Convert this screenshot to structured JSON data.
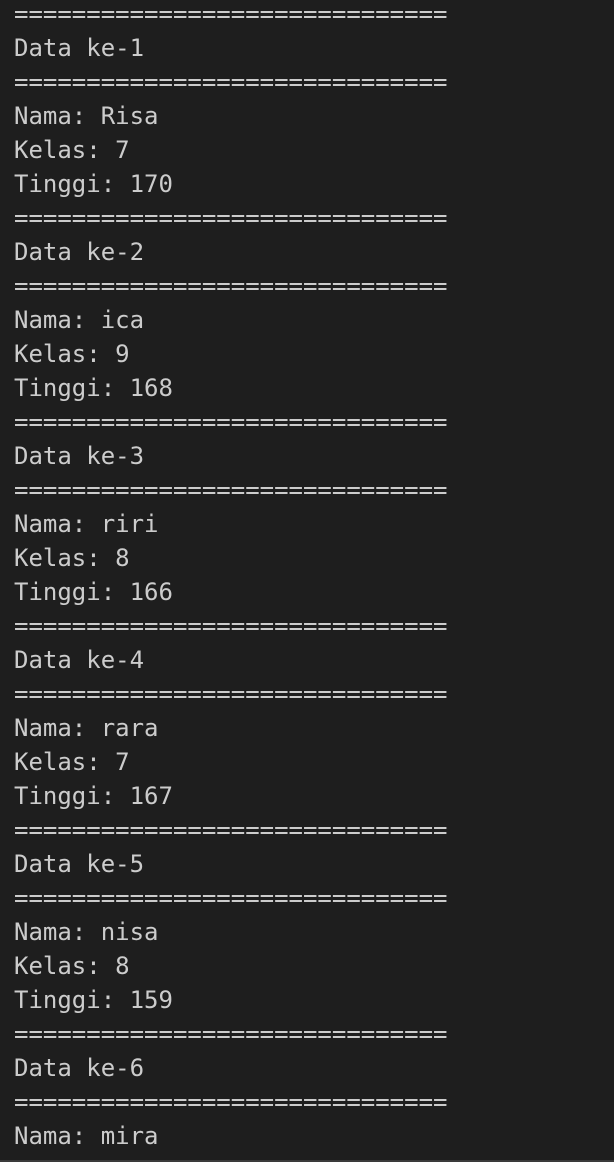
{
  "terminal": {
    "lines": [
      "==============================",
      "Data ke-1",
      "==============================",
      "Nama: Risa",
      "Kelas: 7",
      "Tinggi: 170",
      "==============================",
      "Data ke-2",
      "==============================",
      "Nama: ica",
      "Kelas: 9",
      "Tinggi: 168",
      "==============================",
      "Data ke-3",
      "==============================",
      "Nama: riri",
      "Kelas: 8",
      "Tinggi: 166",
      "==============================",
      "Data ke-4",
      "==============================",
      "Nama: rara",
      "Kelas: 7",
      "Tinggi: 167",
      "==============================",
      "Data ke-5",
      "==============================",
      "Nama: nisa",
      "Kelas: 8",
      "Tinggi: 159",
      "==============================",
      "Data ke-6",
      "==============================",
      "Nama: mira"
    ]
  },
  "colors": {
    "background": "#1e1e1e",
    "text": "#cccccc"
  }
}
